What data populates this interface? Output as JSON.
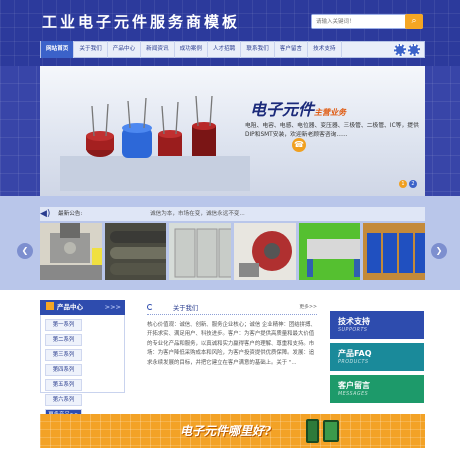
{
  "header": {
    "site_title": "工业电子元件服务商模板",
    "search_placeholder": "请输入关键词！",
    "search_icon": "search-icon"
  },
  "nav": {
    "items": [
      "网站首页",
      "关于我们",
      "产品中心",
      "新闻资讯",
      "成功案例",
      "人才招聘",
      "联系我们",
      "客户留言",
      "技术支持"
    ],
    "active": "网站首页"
  },
  "banner": {
    "title": "电子元件",
    "subtitle": "主营业务",
    "description": "电阻、电容、电感、电位器、变压器、三极管、二极管、IC等，提供DIP和SMT安装，欢迎新老顾客咨询......",
    "pages": [
      "1",
      "2"
    ],
    "active_page": "2"
  },
  "notice": {
    "label": "最新公告:",
    "text": "诚信为本，市场在变，诚信永远不变..."
  },
  "carousel": {
    "items": [
      "machine",
      "rollers",
      "cabinets",
      "gears",
      "filter-press",
      "cabinets-row"
    ]
  },
  "sidebar": {
    "title": "产品中心",
    "title_suffix": ">>>",
    "categories": [
      "第一系列",
      "第二系列",
      "第三系列",
      "第四系列",
      "第五系列",
      "第六系列"
    ],
    "more": "更多产品>>"
  },
  "about": {
    "title": "关于我们",
    "more": "更多>>",
    "text": "核心价值观：诚信、创新、服务企业核心；诚信 企业精神：团结拼搏、开拓求实、满足用户、科技进步。客户：为客户提供高质量和最大价值的专业化产品和服务，以真诚和实力赢得客户的理解、尊重和支持。市场：为客户降低采购成本和风险，为客户投资提供优质保障。发展：追求永续发展的目标，并把它建立在客户满意的基础上。关于 \"..."
  },
  "right_buttons": [
    {
      "label": "技术支持",
      "en": "SUPPORTS",
      "color": "#2e4cae"
    },
    {
      "label": "产品FAQ",
      "en": "PRODUCTS",
      "color": "#1a8a9a"
    },
    {
      "label": "客户留言",
      "en": "MESSAGES",
      "color": "#1d9a6a"
    }
  ],
  "bottom_banner": {
    "text": "电子元件哪里好?"
  }
}
